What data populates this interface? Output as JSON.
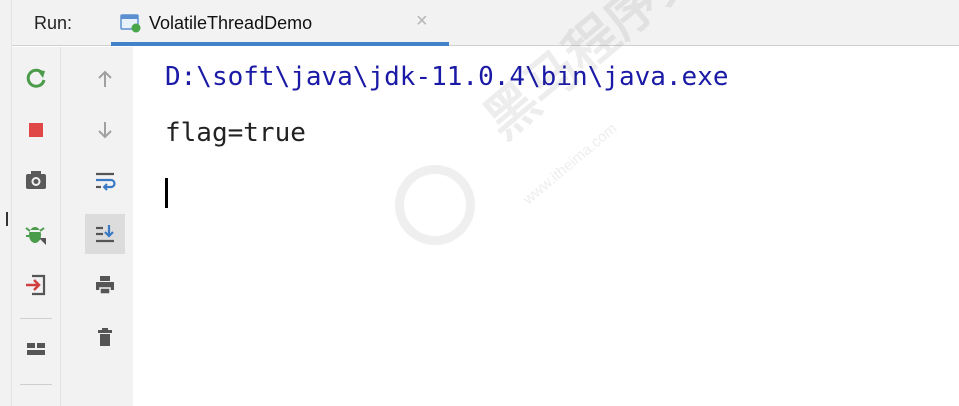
{
  "tool_window": {
    "run_label": "Run:",
    "tab": {
      "title": "VolatileThreadDemo",
      "close_glyph": "×",
      "icon": "run-config-icon"
    }
  },
  "toolbar": {
    "left_column": [
      {
        "name": "rerun-icon",
        "color": "#4a9b4a"
      },
      {
        "name": "stop-icon",
        "color": "#e04848"
      },
      {
        "name": "camera-icon",
        "color": "#5a5a5a"
      },
      {
        "name": "debug-bug-icon",
        "color": "#4a9b4a"
      },
      {
        "name": "login-import-icon",
        "color": "#d04040"
      },
      {
        "name": "layout-icon",
        "color": "#555555"
      }
    ],
    "right_column": [
      {
        "name": "arrow-up-icon",
        "color": "#a0a0a0"
      },
      {
        "name": "arrow-down-icon",
        "color": "#a0a0a0"
      },
      {
        "name": "soft-wrap-icon",
        "color": "#3a7ac4"
      },
      {
        "name": "scroll-to-end-icon",
        "color": "#3a7ac4",
        "pressed": true
      },
      {
        "name": "print-icon",
        "color": "#555555"
      },
      {
        "name": "trash-icon",
        "color": "#555555"
      }
    ]
  },
  "console": {
    "lines": [
      "D:\\soft\\java\\jdk-11.0.4\\bin\\java.exe",
      "flag=true"
    ]
  },
  "watermark": {
    "brand": "黑马程序员",
    "url": "www.itheima.com"
  },
  "colors": {
    "accent": "#4083c9",
    "command_text": "#1a1aa6",
    "output_text": "#222222"
  }
}
